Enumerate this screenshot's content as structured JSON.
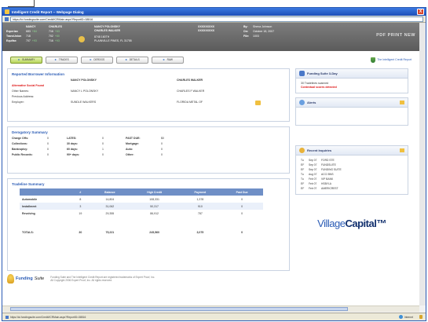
{
  "window": {
    "title": "Intelligent Credit Report -- Webpage Dialog",
    "close_label": "X",
    "url": "https://ici.fundingsuite.com/Credit/ICRMain.aspx?ReportID=38516"
  },
  "header": {
    "score_headers": [
      "NANCY",
      "CHARLES"
    ],
    "scores": [
      {
        "label": "Experian",
        "v1": "683",
        "d1": "+84",
        "v2": "716",
        "d2": "+83"
      },
      {
        "label": "TransUnion",
        "v1": "718",
        "d1": "",
        "v2": "702",
        "d2": "+80"
      },
      {
        "label": "Equifax",
        "v1": "707",
        "d1": "+93",
        "v2": "716",
        "d2": "+93"
      }
    ],
    "borrower_name": "NANCY POLONSKY",
    "coborrower_name": "CHARLES WALKER",
    "ssn1": "XXXXXXXXX",
    "ssn2": "XXXXXXXXX",
    "address_line1": "8748 160TH",
    "address_line2": "PLAINVILLE PINES, FL 31755",
    "meta": [
      {
        "label": "By:",
        "value": "Shena Johnson"
      },
      {
        "label": "On:",
        "value": "October 18, 2007"
      },
      {
        "label": "File:",
        "value": "1003"
      }
    ],
    "pdf_links": "PDF  PRINT  NEW"
  },
  "toolbar": {
    "buttons": [
      {
        "label": "SUMMARY",
        "active": true
      },
      {
        "label": "TRADES",
        "active": false
      },
      {
        "label": "DEROGS",
        "active": false
      },
      {
        "label": "DETAILS",
        "active": false
      },
      {
        "label": "RAW",
        "active": false
      }
    ],
    "brand": "The Intelligent Credit Report"
  },
  "reported_info": {
    "title": "Reported Borrower Information",
    "col1": "NANCY POLONSKY",
    "col2": "CHARLES WALKER",
    "alert_label": "Alternative Social Found",
    "rows": [
      {
        "label": "Other Names:",
        "b1": "NANCY L POLONSKY",
        "b2": "CHARLES F WALKER"
      },
      {
        "label": "Previous Address:",
        "b1": "",
        "b2": ""
      },
      {
        "label": "Employer:",
        "b1": "SUNDLE WALKERS",
        "b2": "FLORIDA METAL OF"
      }
    ]
  },
  "derog": {
    "title": "Derogatory Summary",
    "rows": [
      {
        "l1": "Charge Offs:",
        "v1": "0",
        "l2": "LATES:",
        "v2": "0",
        "l3": "PAST DUE:",
        "v3": "$0",
        "l4": "",
        "v4": ""
      },
      {
        "l1": "Collections:",
        "v1": "0",
        "l2": "30 days:",
        "v2": "0",
        "l3": "Mortgage:",
        "v3": "0",
        "l4": "",
        "v4": ""
      },
      {
        "l1": "Bankruptcy:",
        "v1": "0",
        "l2": "60 days:",
        "v2": "1",
        "l3": "Auto:",
        "v3": "0",
        "l4": "",
        "v4": ""
      },
      {
        "l1": "Public Records:",
        "v1": "0",
        "l2": "90+ days:",
        "v2": "0",
        "l3": "Other:",
        "v3": "0",
        "l4": "",
        "v4": ""
      }
    ]
  },
  "tradeline": {
    "title": "Tradeline Summary",
    "headers": [
      "",
      "#",
      "Balance",
      "High Credit",
      "Payment",
      "Past Due"
    ],
    "rows": [
      [
        "Automobile",
        "8",
        "14,804",
        "108,331",
        "1,378",
        "0"
      ],
      [
        "Installment",
        "3",
        "31,062",
        "50,317",
        "910",
        "0"
      ],
      [
        "Revolving",
        "19",
        "29,355",
        "86,912",
        "787",
        "0"
      ]
    ],
    "totals": [
      "TOTALS:",
      "30",
      "75,221",
      "245,560",
      "3,075",
      "0"
    ]
  },
  "funding_panel": {
    "title": "Funding Suite 3-Day",
    "line1": "30 Tradelines scanned",
    "line2": "Contextual scores detected"
  },
  "alerts_panel": {
    "title": "Alerts"
  },
  "inquiries_panel": {
    "title": "Recent Inquiries",
    "items": [
      {
        "who": "Tu",
        "date": "Sep 07",
        "name": "FORD STE"
      },
      {
        "who": "EF",
        "date": "Sep 07",
        "name": "FUNDSUITE"
      },
      {
        "who": "EF",
        "date": "Sep 07",
        "name": "FUNDING SUITE"
      },
      {
        "who": "Tu",
        "date": "Aug 07",
        "name": "ACCI BNS"
      },
      {
        "who": "Tu",
        "date": "Feb 07",
        "name": "VIP BANK"
      },
      {
        "who": "EF",
        "date": "Feb 07",
        "name": "HSBYLA"
      },
      {
        "who": "EF",
        "date": "Feb 07",
        "name": "AMERICREST"
      }
    ]
  },
  "brand_logo": {
    "part1": "Village",
    "part2": "Capital",
    "mark": "™"
  },
  "footer": {
    "logo_part1": "Funding",
    "logo_part2": "Suite",
    "legal1": "Funding Suite and The Intelligent Credit Report are registered trademarks of Expert Proof, Inc.",
    "legal2": "All Copyright 2006 Expert Proof, Inc. All rights reserved."
  },
  "status": {
    "url": "https://ici.fundingsuite.com/Credit/ICRMain.aspx?ReportID=38516",
    "zone": "Internet"
  }
}
